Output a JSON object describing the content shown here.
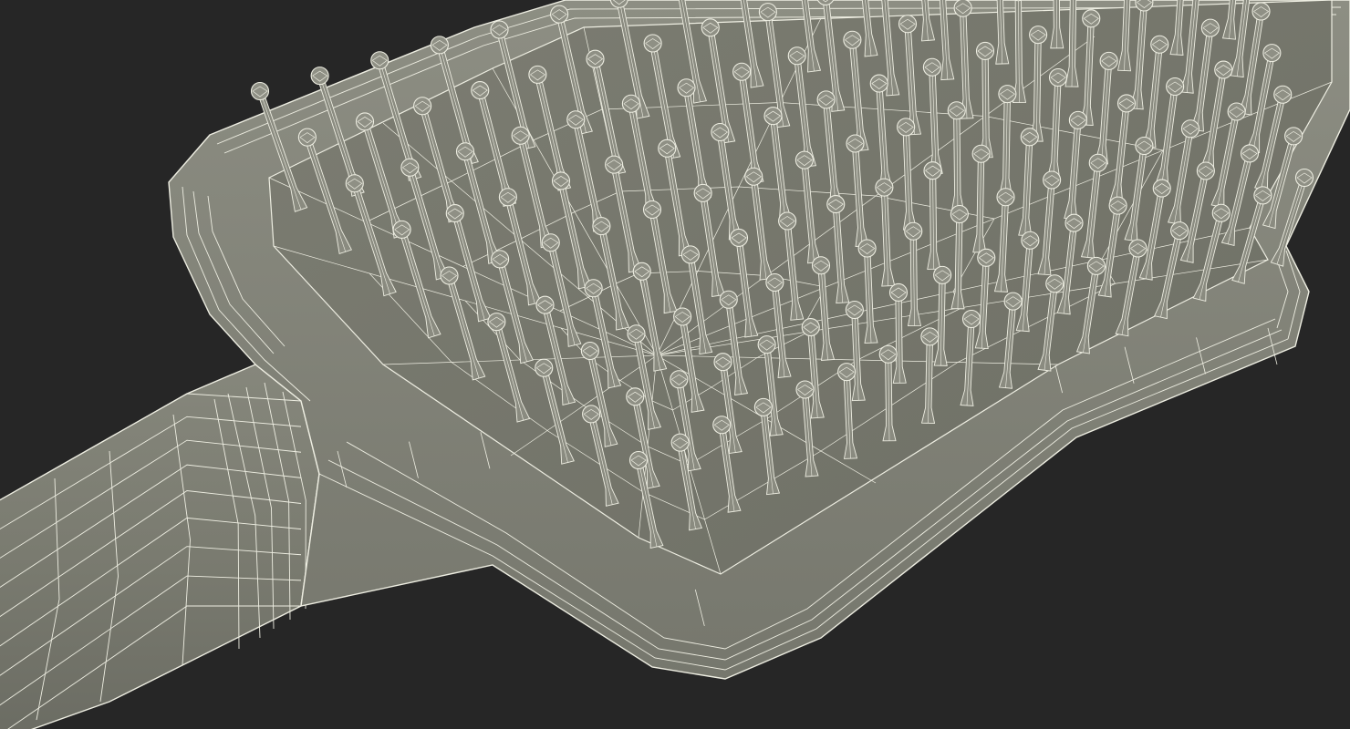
{
  "scene": {
    "subject": "hairbrush-wireframe-render",
    "colors": {
      "background": "#262626",
      "body_fill": "#7a7b70",
      "body_fill_dark": "#6b6c62",
      "pad_fill": "#73746a",
      "rim_fill": "#84857a",
      "handle_fill": "#7d7e73",
      "wire": "#eeeee2",
      "pin_fill": "#8a8b80"
    }
  }
}
